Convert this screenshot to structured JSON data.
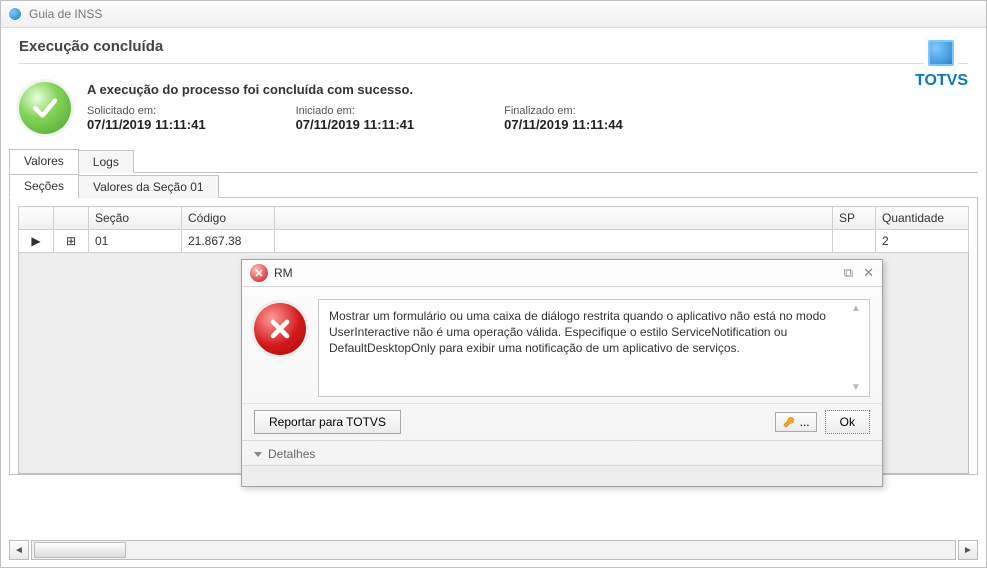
{
  "title": "Guia de INSS",
  "header": {
    "title": "Execução concluída",
    "brand": "TOTVS"
  },
  "exec": {
    "message": "A execução do processo foi concluída com sucesso.",
    "solicited_label": "Solicitado em:",
    "solicited_value": "07/11/2019 11:11:41",
    "started_label": "Iniciado em:",
    "started_value": "07/11/2019 11:11:41",
    "finished_label": "Finalizado em:",
    "finished_value": "07/11/2019 11:11:44"
  },
  "tabs": {
    "valores": "Valores",
    "logs": "Logs",
    "secoes": "Seções",
    "valores_secao": "Valores da Seção 01"
  },
  "grid": {
    "headers": {
      "secao": "Seção",
      "codigo": "Código",
      "sp_placeholder": "SP",
      "quantidade": "Quantidade"
    },
    "row": {
      "secao": "01",
      "codigo": "21.867.38",
      "quantidade": "2"
    }
  },
  "modal": {
    "title": "RM",
    "message": "Mostrar um formulário ou uma caixa de diálogo restrita quando o aplicativo não está no modo UserInteractive não é uma operação válida. Especifique o estilo ServiceNotification ou DefaultDesktopOnly para exibir uma notificação de um aplicativo de serviços.",
    "report_button": "Reportar para TOTVS",
    "more_button": "...",
    "ok_button": "Ok",
    "details_label": "Detalhes"
  }
}
